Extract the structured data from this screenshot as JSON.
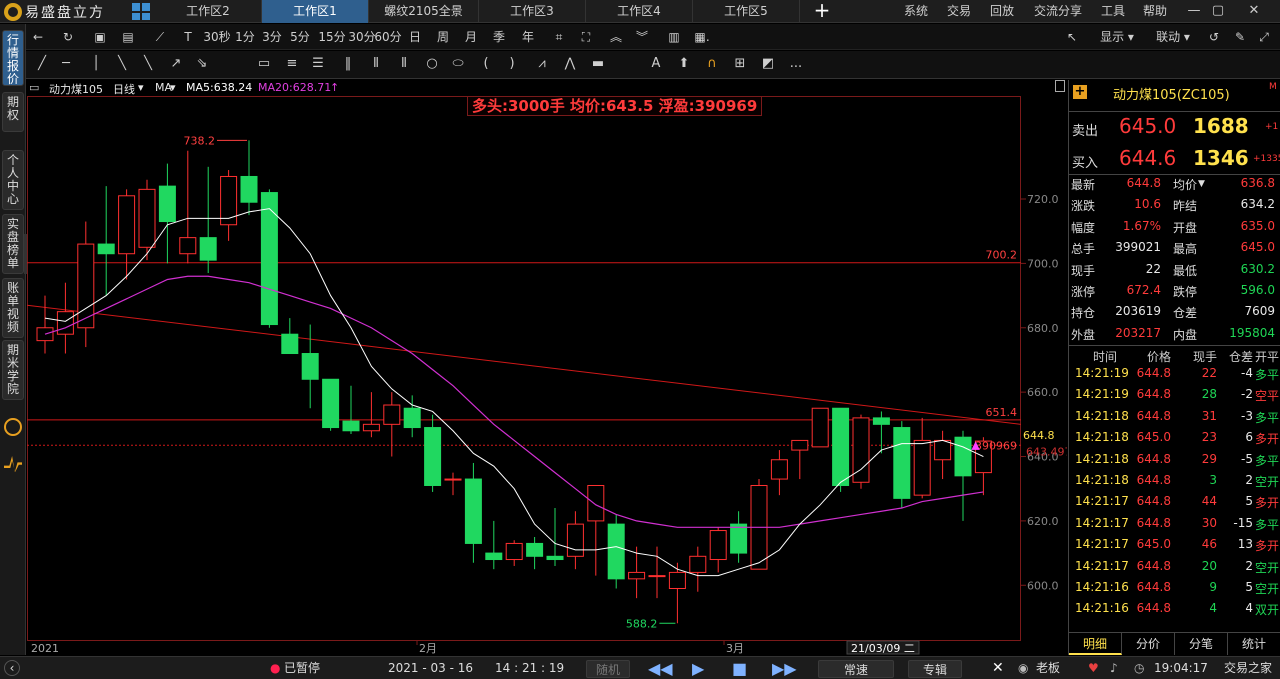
{
  "titlebar": {
    "app_name": "易盛盘立方",
    "tabs": [
      "工作区2",
      "工作区1",
      "螺纹2105全景",
      "工作区3",
      "工作区4",
      "工作区5"
    ],
    "active_tab": 1,
    "menus": [
      "系统",
      "交易",
      "回放",
      "交流分享",
      "工具",
      "帮助"
    ]
  },
  "toolbar": {
    "periods": [
      "30秒",
      "1分",
      "3分",
      "5分",
      "15分",
      "30分",
      "60分",
      "日",
      "周",
      "月",
      "季",
      "年"
    ],
    "more": "...",
    "display_label": "显示",
    "link_label": "联动"
  },
  "leftbar": {
    "items": [
      "行情报价",
      "期权",
      "个人中心",
      "实盘榜单",
      "账单视频",
      "期米学院"
    ]
  },
  "chart": {
    "symbol": "动力煤105",
    "period": "日线",
    "indicator": "MA",
    "ma5": "MA5:638.24",
    "ma20": "MA20:628.71",
    "position_text": "多头:3000手 均价:643.5 浮盈:390969",
    "high_label": "738.2",
    "low_label": "588.2",
    "hline1_label": "700.2",
    "hline2_label": "651.4",
    "last_price_label": "644.8",
    "avg_price_label": "643.497",
    "pnl_label": "390969",
    "date_cursor": "21/03/09 二",
    "x_labels": [
      "2021",
      "2月",
      "3月"
    ],
    "y_ticks": [
      "720.0",
      "700.0",
      "680.0",
      "660.0",
      "640.0",
      "620.0",
      "600.0"
    ]
  },
  "chart_data": {
    "type": "candlestick",
    "title": "动力煤105 日线",
    "ylim": [
      583,
      752
    ],
    "y_ticks": [
      720,
      700,
      680,
      660,
      640,
      620,
      600
    ],
    "candles": [
      {
        "o": 676,
        "h": 690,
        "l": 672,
        "c": 680
      },
      {
        "o": 678,
        "h": 694,
        "l": 672,
        "c": 685
      },
      {
        "o": 680,
        "h": 713,
        "l": 674,
        "c": 706
      },
      {
        "o": 706,
        "h": 724,
        "l": 690,
        "c": 703
      },
      {
        "o": 703,
        "h": 723,
        "l": 695,
        "c": 721
      },
      {
        "o": 705,
        "h": 726,
        "l": 701,
        "c": 723
      },
      {
        "o": 724,
        "h": 731,
        "l": 700,
        "c": 713
      },
      {
        "o": 703,
        "h": 735,
        "l": 700,
        "c": 708
      },
      {
        "o": 708,
        "h": 730,
        "l": 697,
        "c": 701
      },
      {
        "o": 712,
        "h": 729,
        "l": 707,
        "c": 727
      },
      {
        "o": 727,
        "h": 738.2,
        "l": 715,
        "c": 719
      },
      {
        "o": 722,
        "h": 723,
        "l": 680,
        "c": 681
      },
      {
        "o": 678,
        "h": 683,
        "l": 672,
        "c": 672
      },
      {
        "o": 672,
        "h": 681,
        "l": 655,
        "c": 664
      },
      {
        "o": 664,
        "h": 664,
        "l": 648,
        "c": 649
      },
      {
        "o": 651,
        "h": 662,
        "l": 647,
        "c": 648
      },
      {
        "o": 648,
        "h": 660,
        "l": 646,
        "c": 650
      },
      {
        "o": 650,
        "h": 660,
        "l": 640,
        "c": 656
      },
      {
        "o": 655,
        "h": 659,
        "l": 646,
        "c": 649
      },
      {
        "o": 649,
        "h": 653,
        "l": 629,
        "c": 631
      },
      {
        "o": 633,
        "h": 635,
        "l": 628,
        "c": 633
      },
      {
        "o": 633,
        "h": 638,
        "l": 607,
        "c": 613
      },
      {
        "o": 610,
        "h": 620,
        "l": 605,
        "c": 608
      },
      {
        "o": 608,
        "h": 614,
        "l": 606,
        "c": 613
      },
      {
        "o": 613,
        "h": 615,
        "l": 605,
        "c": 609
      },
      {
        "o": 609,
        "h": 624,
        "l": 606,
        "c": 608
      },
      {
        "o": 609,
        "h": 623,
        "l": 605,
        "c": 619
      },
      {
        "o": 620,
        "h": 631,
        "l": 603,
        "c": 631
      },
      {
        "o": 619,
        "h": 622,
        "l": 599,
        "c": 602
      },
      {
        "o": 602,
        "h": 612,
        "l": 596,
        "c": 604
      },
      {
        "o": 603,
        "h": 612,
        "l": 596,
        "c": 603
      },
      {
        "o": 599,
        "h": 607,
        "l": 588.2,
        "c": 604
      },
      {
        "o": 604,
        "h": 612,
        "l": 598,
        "c": 609
      },
      {
        "o": 608,
        "h": 618,
        "l": 604,
        "c": 617
      },
      {
        "o": 619,
        "h": 623,
        "l": 607,
        "c": 610
      },
      {
        "o": 605,
        "h": 633,
        "l": 605,
        "c": 631
      },
      {
        "o": 633,
        "h": 642,
        "l": 628,
        "c": 639
      },
      {
        "o": 642,
        "h": 645,
        "l": 633,
        "c": 645
      },
      {
        "o": 643,
        "h": 655,
        "l": 643,
        "c": 655
      },
      {
        "o": 655,
        "h": 655,
        "l": 629,
        "c": 631
      },
      {
        "o": 632,
        "h": 653,
        "l": 630,
        "c": 652
      },
      {
        "o": 652,
        "h": 654,
        "l": 641,
        "c": 650
      },
      {
        "o": 649,
        "h": 651,
        "l": 624,
        "c": 627
      },
      {
        "o": 628,
        "h": 652,
        "l": 627,
        "c": 645
      },
      {
        "o": 639,
        "h": 648,
        "l": 633,
        "c": 645
      },
      {
        "o": 646,
        "h": 648,
        "l": 620,
        "c": 634
      },
      {
        "o": 635,
        "h": 646,
        "l": 628,
        "c": 644.8
      }
    ],
    "ma5": [
      683,
      682,
      686,
      690,
      696,
      703,
      712,
      714,
      714,
      714,
      716,
      717,
      711,
      703,
      690,
      680,
      668,
      661,
      656,
      654,
      648,
      641,
      637,
      630,
      619,
      613,
      611,
      611,
      612,
      610,
      609,
      605,
      603,
      603,
      605,
      607,
      611,
      619,
      625,
      632,
      636,
      642,
      644,
      644,
      645,
      643,
      640
    ],
    "ma20": [
      678,
      680,
      683,
      686,
      689,
      692,
      695,
      696,
      696,
      695,
      694,
      692,
      690,
      688,
      686,
      683,
      680,
      676,
      672,
      667,
      662,
      656,
      650,
      645,
      640,
      635,
      630,
      625,
      622,
      620,
      619,
      618,
      618,
      618,
      618,
      618,
      618,
      619,
      620,
      621,
      622,
      623,
      624,
      626,
      627,
      628,
      629
    ],
    "hlines": [
      700.2,
      651.4
    ],
    "trendline": [
      [
        0,
        687
      ],
      [
        46,
        650
      ]
    ]
  },
  "panel": {
    "title": "动力煤105(ZC105)",
    "ask_label": "卖出",
    "ask_price": "645.0",
    "ask_vol": "1688",
    "ask_delta": "+1",
    "bid_label": "买入",
    "bid_price": "644.6",
    "bid_vol": "1346",
    "bid_delta": "+1335",
    "stats": [
      [
        "最新",
        "644.8",
        "均价",
        "636.8"
      ],
      [
        "涨跌",
        "10.6",
        "昨结",
        "634.2"
      ],
      [
        "幅度",
        "1.67%",
        "开盘",
        "635.0"
      ],
      [
        "总手",
        "399021",
        "最高",
        "645.0"
      ],
      [
        "现手",
        "22",
        "最低",
        "630.2"
      ],
      [
        "涨停",
        "672.4",
        "跌停",
        "596.0"
      ],
      [
        "持仓",
        "203619",
        "仓差",
        "7609"
      ],
      [
        "外盘",
        "203217",
        "内盘",
        "195804"
      ]
    ],
    "trade_headers": [
      "时间",
      "价格",
      "现手",
      "仓差",
      "开平"
    ],
    "trades": [
      [
        "14:21:19",
        "644.8",
        "22",
        "-4",
        "多平"
      ],
      [
        "14:21:19",
        "644.8",
        "28",
        "-2",
        "空平"
      ],
      [
        "14:21:18",
        "644.8",
        "31",
        "-3",
        "多平"
      ],
      [
        "14:21:18",
        "645.0",
        "23",
        "6",
        "多开"
      ],
      [
        "14:21:18",
        "644.8",
        "29",
        "-5",
        "多平"
      ],
      [
        "14:21:18",
        "644.8",
        "3",
        "2",
        "空开"
      ],
      [
        "14:21:17",
        "644.8",
        "44",
        "5",
        "多开"
      ],
      [
        "14:21:17",
        "644.8",
        "30",
        "-15",
        "多平"
      ],
      [
        "14:21:17",
        "645.0",
        "46",
        "13",
        "多开"
      ],
      [
        "14:21:17",
        "644.8",
        "20",
        "2",
        "空开"
      ],
      [
        "14:21:16",
        "644.8",
        "9",
        "5",
        "空开"
      ],
      [
        "14:21:16",
        "644.8",
        "4",
        "4",
        "双开"
      ]
    ],
    "tabs": [
      "明细",
      "分价",
      "分笔",
      "统计"
    ]
  },
  "statusbar": {
    "paused": "已暂停",
    "date": "2021 - 03 - 16",
    "time": "14 : 21 : 19",
    "random_label": "随机",
    "speed_label": "常速",
    "mode_label": "专辑",
    "user": "老板",
    "clock": "19:04:17",
    "trade_house": "交易之家"
  }
}
